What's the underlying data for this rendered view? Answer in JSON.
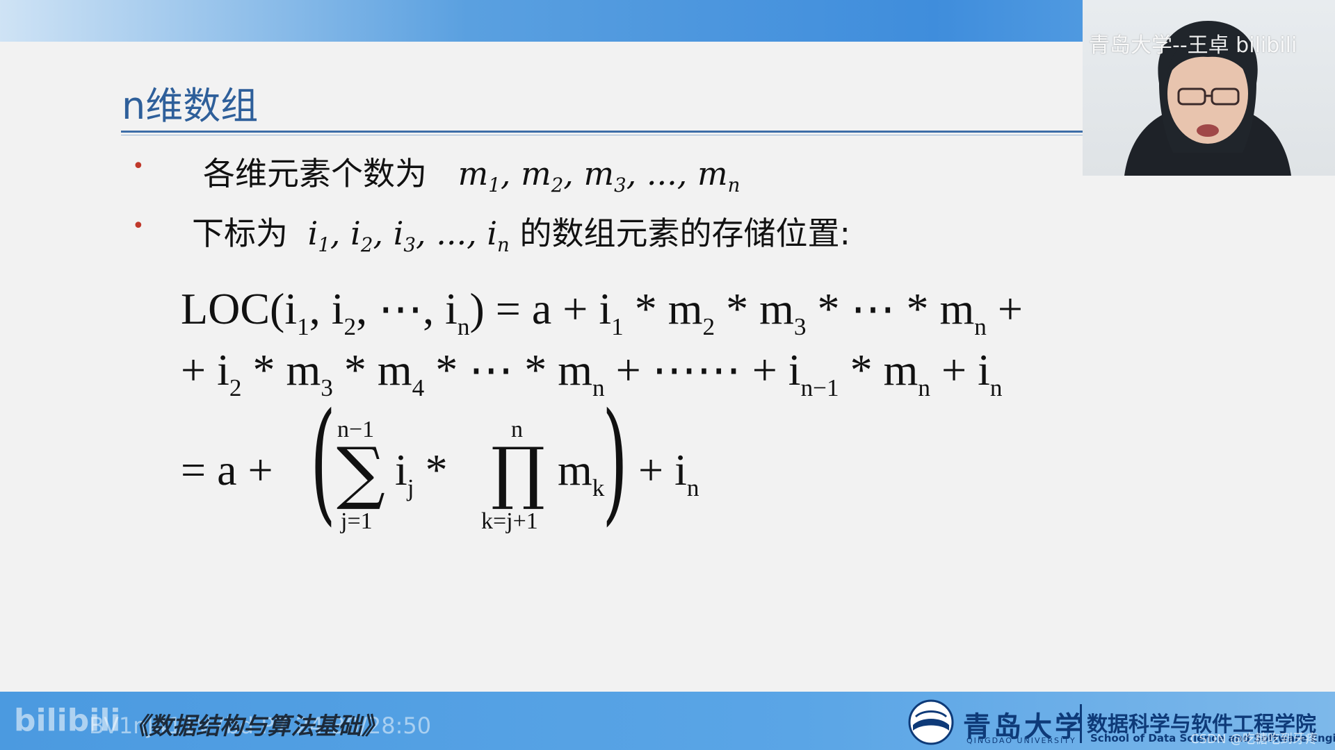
{
  "slide": {
    "title": "n维数组",
    "bullet_glyph": "•",
    "bullet1_text": "各维元素个数为",
    "bullet1_math": [
      "m",
      "1",
      ", ",
      "m",
      "2",
      ", ",
      "m",
      "3",
      ", ..., ",
      "m",
      "n"
    ],
    "bullet2_prefix": "下标为",
    "bullet2_math": [
      "i",
      "1",
      ", ",
      "i",
      "2",
      ", ",
      "i",
      "3",
      ", ..., ",
      "i",
      "n"
    ],
    "bullet2_suffix": "的数组元素的存储位置:",
    "formula": {
      "line1": [
        "LOC(i",
        "1",
        ", i",
        "2",
        ", ⋯, i",
        "n",
        ") = a + i",
        "1",
        " * m",
        "2",
        " * m",
        "3",
        " * ⋯ * m",
        "n",
        " +"
      ],
      "line2": [
        "+ i",
        "2",
        " * m",
        "3",
        " * m",
        "4",
        " * ⋯ * m",
        "n",
        " + ⋯⋯ + i",
        "n−1",
        " * m",
        "n",
        " + i",
        "n"
      ],
      "line3_lead": "= a +",
      "sum_symbol": "∑",
      "sum_upper": "n−1",
      "sum_lower": "j=1",
      "term1": [
        "i",
        "j",
        " *"
      ],
      "prod_symbol": "∏",
      "prod_upper": "n",
      "prod_lower": "k=j+1",
      "term2": [
        "m",
        "k"
      ],
      "tail": [
        "+ i",
        "n"
      ],
      "paren_left": "(",
      "paren_right": ")"
    }
  },
  "overlay": {
    "webcam_watermark": "青岛大学--王卓 bilibili",
    "bili_logo": "bilibili",
    "video_id": "BV1nJ411V7bd P7 24:30/28:50",
    "course_title": "《数据结构与算法基础》",
    "university_cn": "青岛大学",
    "university_en": "QINGDAO UNIVERSITY",
    "school_cn": "数据科学与软件工程学院",
    "school_en": "School of Data Science and Software Engineering",
    "csdn_watermark": "CSDN @吃糖吃到牙疼"
  },
  "colors": {
    "title": "#2e5f9a",
    "bullet": "#c0392b",
    "bar": "#4b9ae0",
    "brand_dark": "#0e3a78"
  }
}
